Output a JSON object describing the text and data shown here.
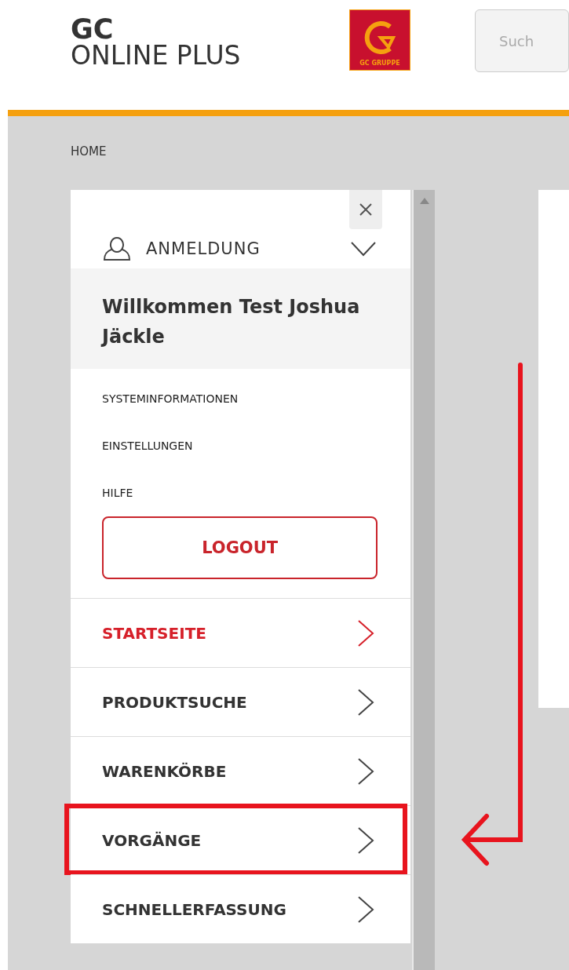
{
  "header": {
    "brand_line_1": "GC",
    "brand_line_2": "ONLINE PLUS",
    "logo_caption": "GC GRUPPE",
    "search": {
      "placeholder": "Such"
    }
  },
  "breadcrumb": "HOME",
  "account": {
    "title": "ANMELDUNG",
    "expanded": true,
    "welcome": "Willkommen Test Joshua Jäckle",
    "links": [
      "SYSTEMINFORMATIONEN",
      "EINSTELLUNGEN",
      "HILFE"
    ],
    "logout": "LOGOUT"
  },
  "menu": [
    {
      "label": "STARTSEITE",
      "selected": true,
      "highlighted": false
    },
    {
      "label": "PRODUKTSUCHE",
      "selected": false,
      "highlighted": false
    },
    {
      "label": "WARENKÖRBE",
      "selected": false,
      "highlighted": false
    },
    {
      "label": "VORGÄNGE",
      "selected": false,
      "highlighted": true
    },
    {
      "label": "SCHNELLERFASSUNG",
      "selected": false,
      "highlighted": false
    }
  ]
}
